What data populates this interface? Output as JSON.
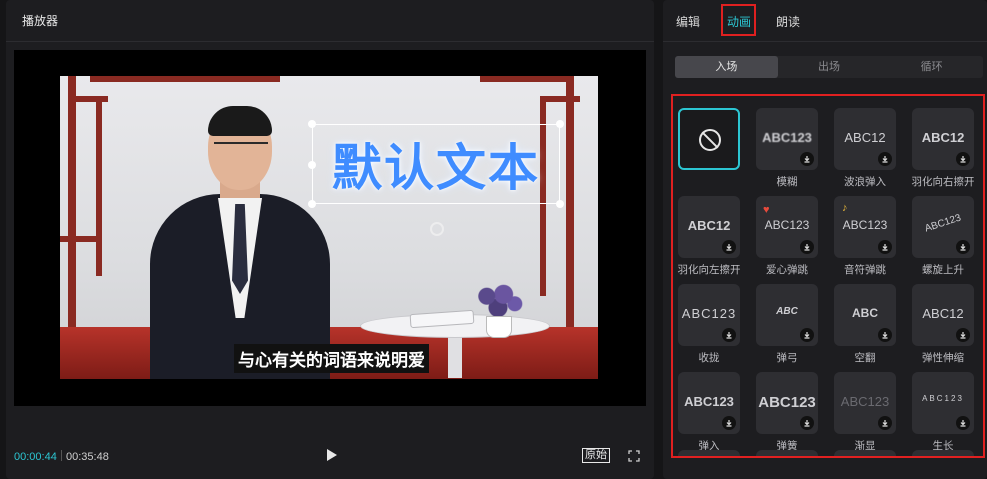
{
  "player": {
    "title": "播放器",
    "overlay_text": "默认文本",
    "subtitle": "与心有关的词语来说明爱",
    "time_current": "00:00:44",
    "time_total": "00:35:48",
    "original_label": "原始"
  },
  "side": {
    "tabs": [
      {
        "label": "编辑",
        "active": false
      },
      {
        "label": "动画",
        "active": true
      },
      {
        "label": "朗读",
        "active": false
      }
    ],
    "subtabs": [
      {
        "label": "入场",
        "active": true
      },
      {
        "label": "出场",
        "active": false
      },
      {
        "label": "循环",
        "active": false
      }
    ],
    "animations": [
      {
        "label": "",
        "thumb": "",
        "icon": "none-icon",
        "selected": true
      },
      {
        "label": "模糊",
        "thumb": "ABC123"
      },
      {
        "label": "波浪弹入",
        "thumb": "ABC12"
      },
      {
        "label": "羽化向右擦开",
        "thumb": "ABC12"
      },
      {
        "label": "羽化向左擦开",
        "thumb": "ABC12"
      },
      {
        "label": "爱心弹跳",
        "thumb": "ABC123"
      },
      {
        "label": "音符弹跳",
        "thumb": "ABC123"
      },
      {
        "label": "螺旋上升",
        "thumb": "ABC123"
      },
      {
        "label": "收拢",
        "thumb": "ABC123"
      },
      {
        "label": "弹弓",
        "thumb": "ABC"
      },
      {
        "label": "空翻",
        "thumb": "ABC"
      },
      {
        "label": "弹性伸缩",
        "thumb": "ABC12"
      },
      {
        "label": "弹入",
        "thumb": "ABC123"
      },
      {
        "label": "弹簧",
        "thumb": "ABC123"
      },
      {
        "label": "渐显",
        "thumb": "ABC123"
      },
      {
        "label": "生长",
        "thumb": "ABC123"
      }
    ]
  },
  "colors": {
    "accent": "#2cc6d2",
    "highlight": "#e02020",
    "text_glow": "#3f8cff"
  }
}
